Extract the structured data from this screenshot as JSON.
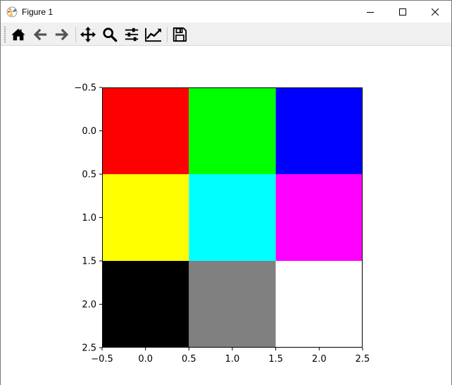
{
  "window": {
    "title": "Figure 1",
    "controls": [
      "minimize-icon",
      "maximize-icon",
      "close-icon"
    ]
  },
  "toolbar": {
    "buttons": [
      "home-icon",
      "back-icon",
      "forward-icon",
      "pan-icon",
      "zoom-icon",
      "configure-subplots-icon",
      "edit-axes-icon",
      "save-icon"
    ]
  },
  "chart_data": {
    "type": "heatmap",
    "title": "",
    "xlabel": "",
    "ylabel": "",
    "xlim": [
      -0.5,
      2.5
    ],
    "ylim": [
      2.5,
      -0.5
    ],
    "grid": false,
    "x_ticks": [
      -0.5,
      0.0,
      0.5,
      1.0,
      1.5,
      2.0,
      2.5
    ],
    "y_ticks": [
      -0.5,
      0.0,
      0.5,
      1.0,
      1.5,
      2.0,
      2.5
    ],
    "x_tick_labels": [
      "−0.5",
      "0.0",
      "0.5",
      "1.0",
      "1.5",
      "2.0",
      "2.5"
    ],
    "y_tick_labels": [
      "−0.5",
      "0.0",
      "0.5",
      "1.0",
      "1.5",
      "2.0",
      "2.5"
    ],
    "cells": [
      [
        [
          255,
          0,
          0
        ],
        [
          0,
          255,
          0
        ],
        [
          0,
          0,
          255
        ]
      ],
      [
        [
          255,
          255,
          0
        ],
        [
          0,
          255,
          255
        ],
        [
          255,
          0,
          255
        ]
      ],
      [
        [
          0,
          0,
          0
        ],
        [
          128,
          128,
          128
        ],
        [
          255,
          255,
          255
        ]
      ]
    ]
  }
}
